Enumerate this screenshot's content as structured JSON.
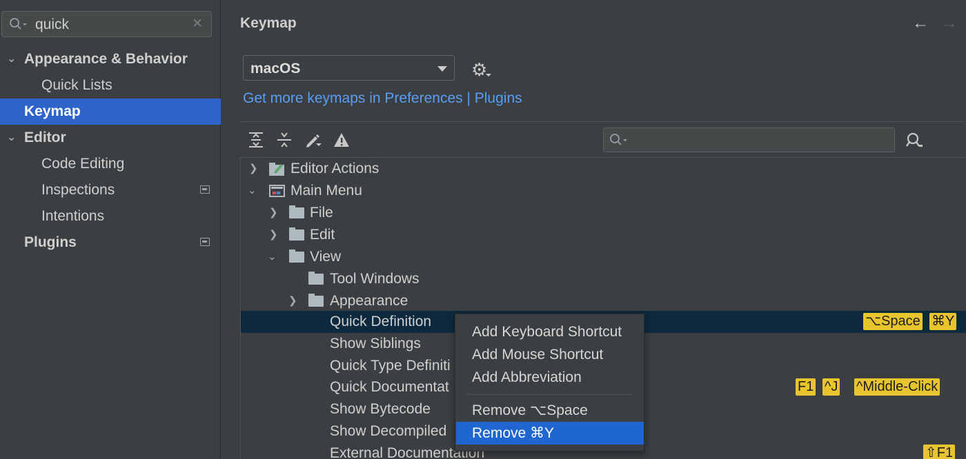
{
  "sidebar": {
    "search_value": "quick",
    "items": [
      {
        "label": "Appearance & Behavior",
        "expanded": true
      },
      {
        "label": "Quick Lists"
      },
      {
        "label": "Keymap",
        "selected": true
      },
      {
        "label": "Editor",
        "expanded": true
      },
      {
        "label": "Code Editing"
      },
      {
        "label": "Inspections",
        "project_scope": true
      },
      {
        "label": "Intentions"
      },
      {
        "label": "Plugins",
        "project_scope": true
      }
    ]
  },
  "header": {
    "title": "Keymap",
    "back_icon": "arrow-left-icon",
    "forward_icon": "arrow-right-icon"
  },
  "keymap": {
    "selected": "macOS",
    "link_text": "Get more keymaps in Preferences | Plugins"
  },
  "toolbar": {
    "icons": [
      "expand-all-icon",
      "collapse-all-icon",
      "edit-shortcut-icon",
      "conflicts-warning-icon",
      "find-by-shortcut-icon"
    ],
    "filter_value": ""
  },
  "tree": {
    "rows": [
      {
        "label": "Editor Actions",
        "arrow": "›",
        "icon": "editor-actions-icon"
      },
      {
        "label": "Main Menu",
        "arrow": "⌄",
        "icon": "main-menu-icon"
      },
      {
        "label": "File",
        "arrow": "›",
        "icon": "folder-icon"
      },
      {
        "label": "Edit",
        "arrow": "›",
        "icon": "folder-icon"
      },
      {
        "label": "View",
        "arrow": "⌄",
        "icon": "folder-icon"
      },
      {
        "label": "Tool Windows",
        "arrow": "",
        "icon": "folder-icon"
      },
      {
        "label": "Appearance",
        "arrow": "›",
        "icon": "folder-icon"
      },
      {
        "label": "Quick Definition",
        "selected": true,
        "shortcuts": [
          "⌥Space",
          "⌘Y"
        ]
      },
      {
        "label": "Show Siblings"
      },
      {
        "label": "Quick Type Definiti"
      },
      {
        "label": "Quick Documentat",
        "shortcuts": [
          "F1",
          "^J",
          "^Middle-Click"
        ]
      },
      {
        "label": "Show Bytecode"
      },
      {
        "label": "Show Decompiled"
      },
      {
        "label": "External Documentation",
        "shortcuts": [
          "⇧F1"
        ]
      }
    ]
  },
  "context_menu": {
    "items": [
      {
        "label": "Add Keyboard Shortcut"
      },
      {
        "label": "Add Mouse Shortcut"
      },
      {
        "label": "Add Abbreviation"
      },
      {
        "label": "Remove ⌥Space"
      },
      {
        "label": "Remove ⌘Y",
        "selected": true
      }
    ]
  },
  "colors": {
    "selection": "#2f65ca",
    "row_selection": "#0d293e",
    "link": "#589df6",
    "shortcut_badge": "#e8c42f"
  }
}
